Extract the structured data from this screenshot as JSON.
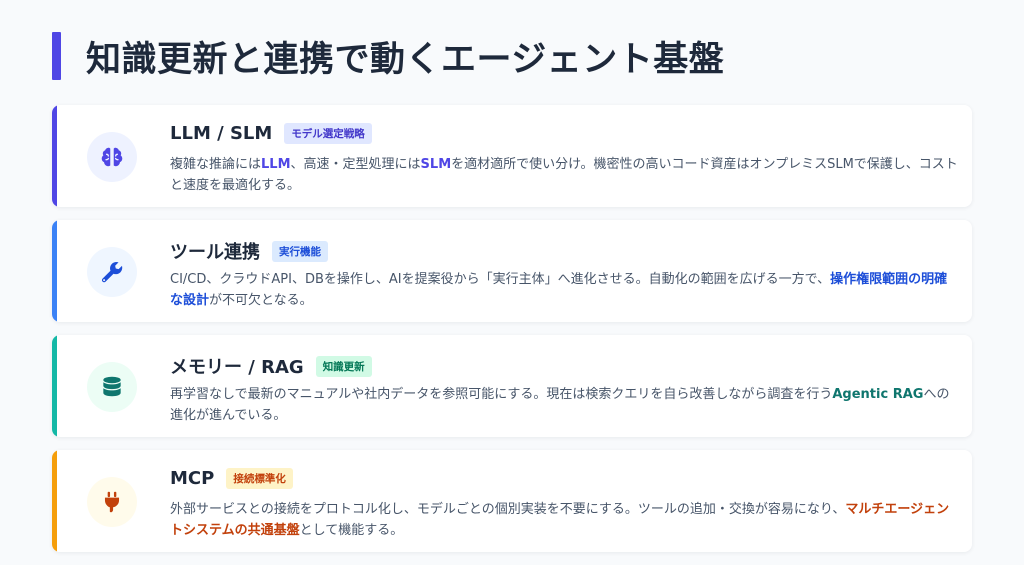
{
  "page": {
    "title": "知識更新と連携で動くエージェント基盤"
  },
  "colors": {
    "title_accent": "#4f46e5",
    "llm": "#4f46e5",
    "tool": "#1d4ed8",
    "memory": "#0f766e",
    "mcp": "#c2410c"
  },
  "cards": [
    {
      "icon": "brain-icon",
      "title": "LLM / SLM",
      "badge": "モデル選定戦略",
      "desc": {
        "t1": "複雑な推論には",
        "b1": "LLM",
        "t2": "、高速・定型処理には",
        "b2": "SLM",
        "t3": "を適材適所で使い分け。機密性の高いコード資産はオンプレミスSLMで保護し、コストと速度を最適化する。"
      }
    },
    {
      "icon": "wrench-icon",
      "title": "ツール連携",
      "badge": "実行機能",
      "desc": {
        "t1": "CI/CD、クラウドAPI、DBを操作し、AIを提案役から「実行主体」へ進化させる。自動化の範囲を広げる一方で、",
        "b1": "操作権限範囲の明確な設計",
        "t2": "が不可欠となる。"
      }
    },
    {
      "icon": "database-icon",
      "title": "メモリー / RAG",
      "badge": "知識更新",
      "desc": {
        "t1": "再学習なしで最新のマニュアルや社内データを参照可能にする。現在は検索クエリを自ら改善しながら調査を行う",
        "b1": "Agentic RAG",
        "t2": "への進化が進んでいる。"
      }
    },
    {
      "icon": "plug-icon",
      "title": "MCP",
      "badge": "接続標準化",
      "desc": {
        "t1": "外部サービスとの接続をプロトコル化し、モデルごとの個別実装を不要にする。ツールの追加・交換が容易になり、",
        "b1": "マルチエージェントシステムの共通基盤",
        "t2": "として機能する。"
      }
    }
  ]
}
